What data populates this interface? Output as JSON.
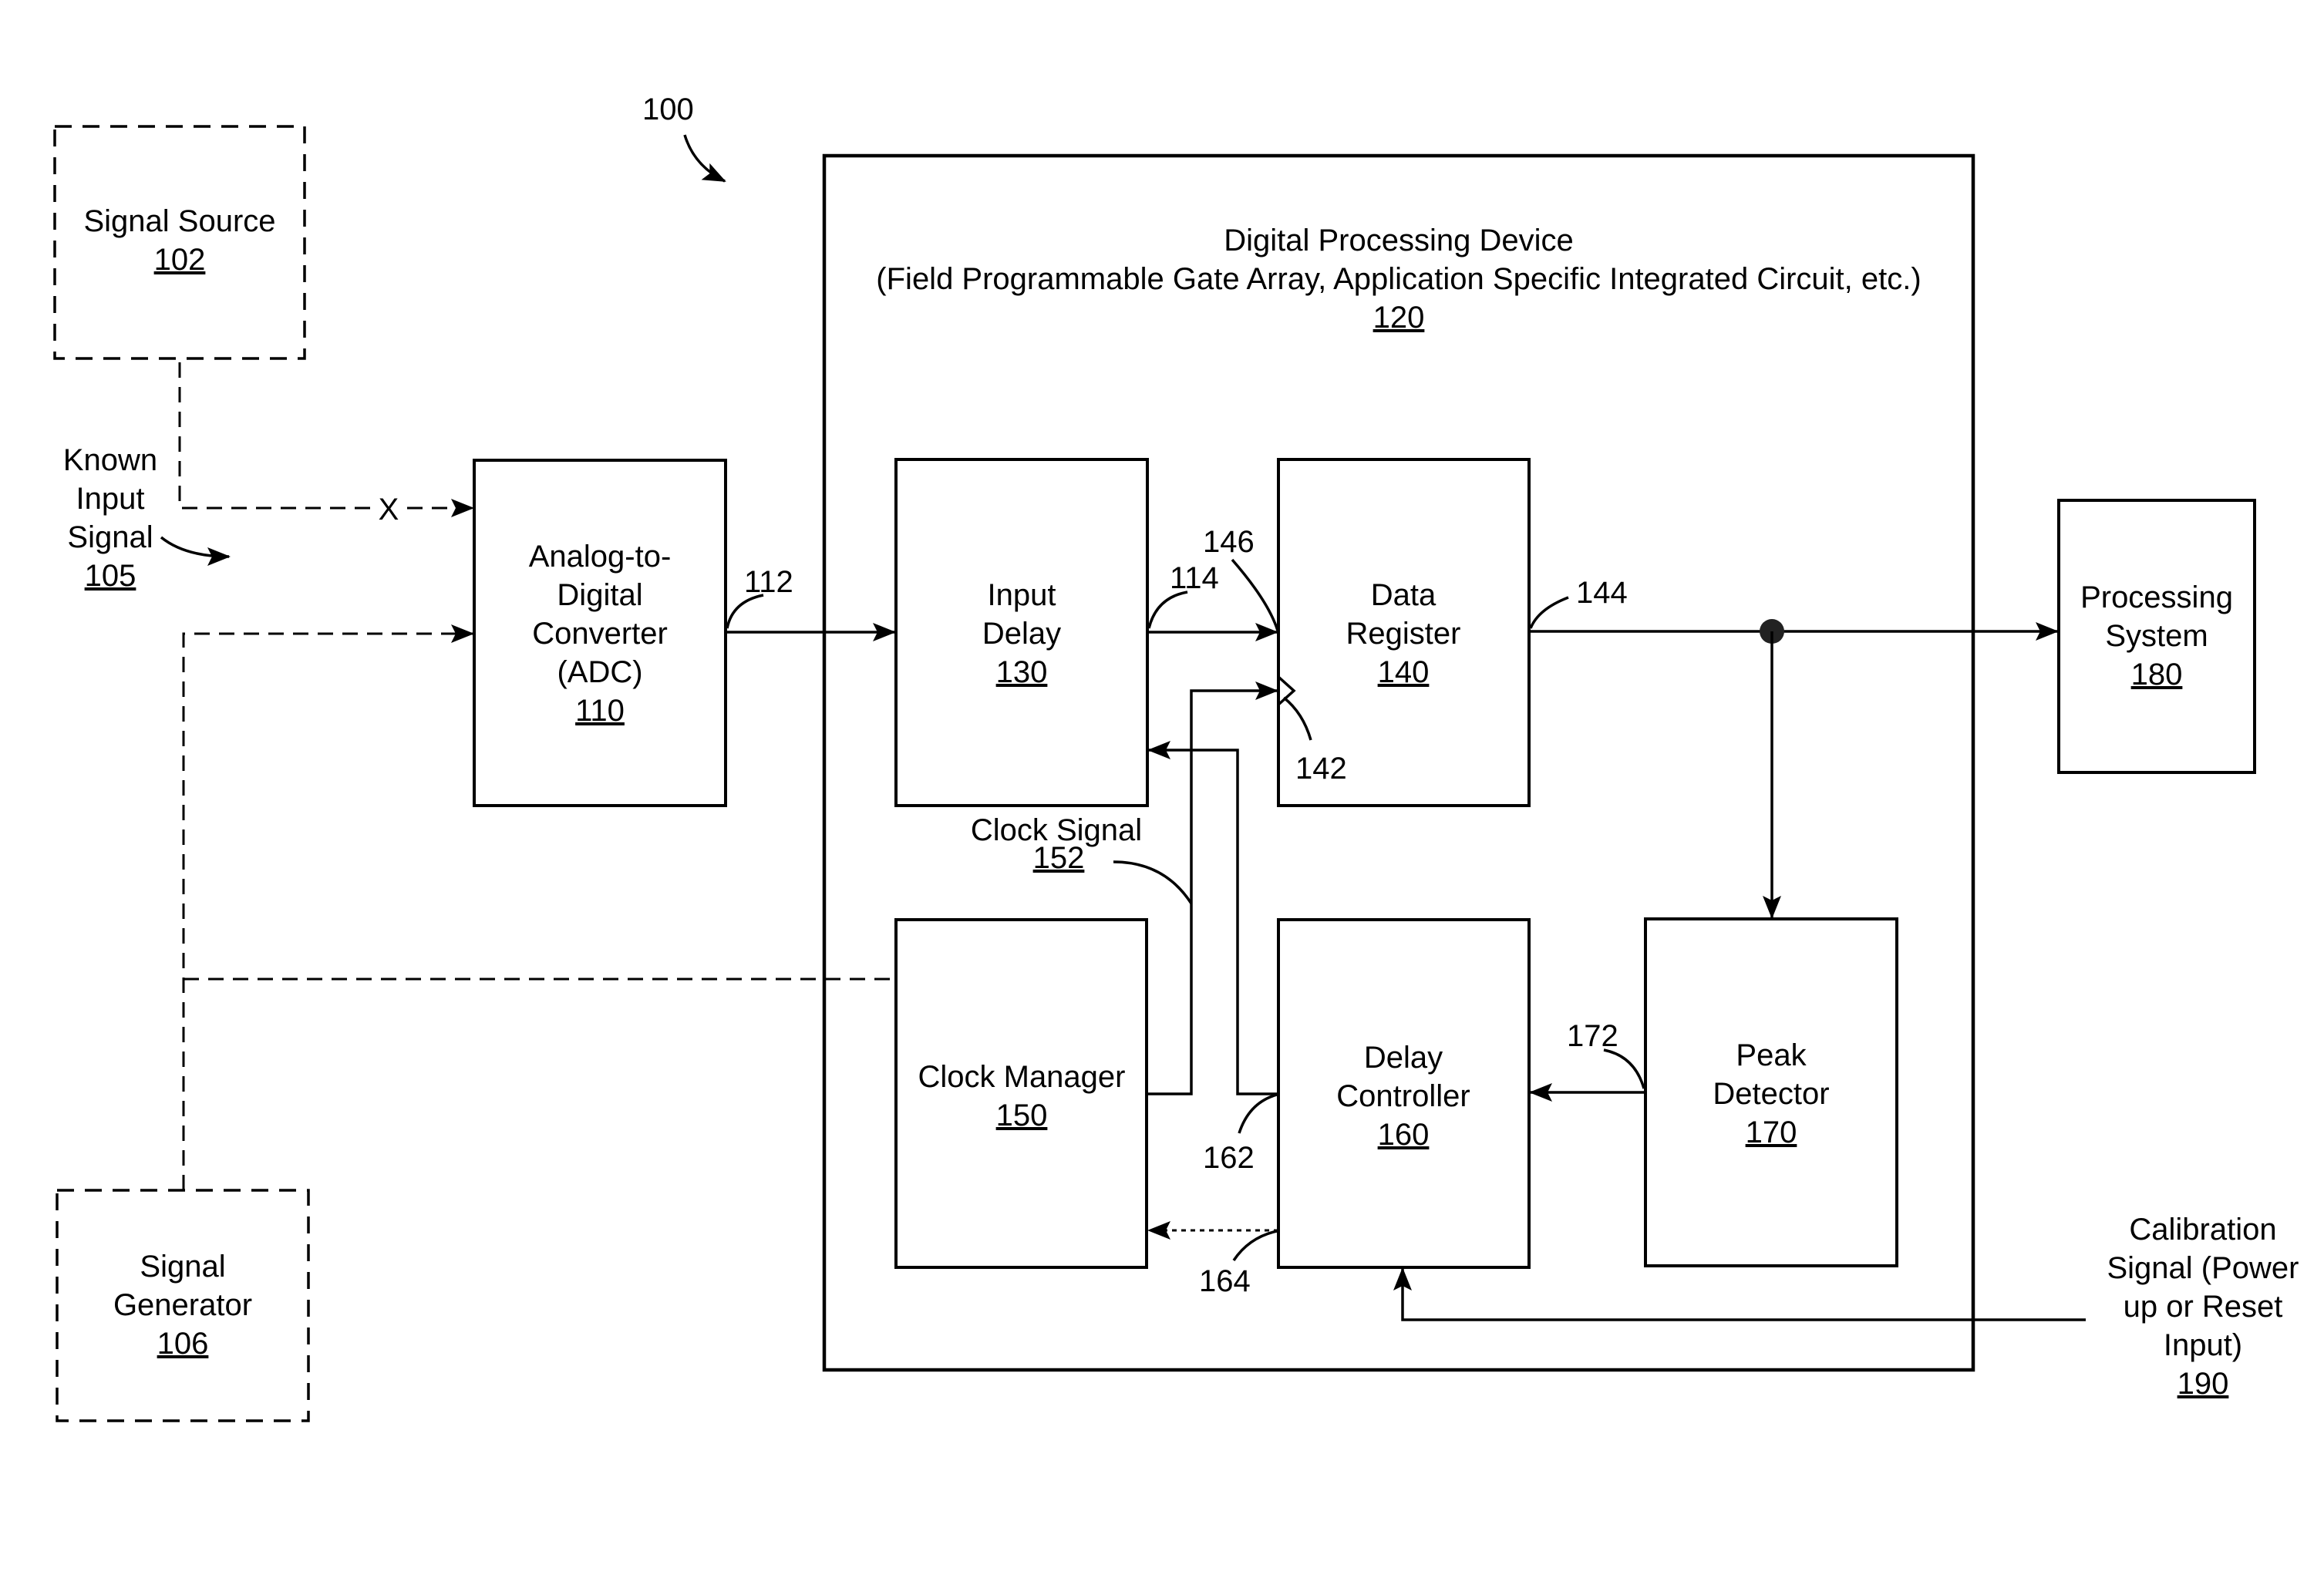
{
  "figure_ref": "100",
  "blocks": {
    "signal_source": {
      "lines": [
        "Signal Source"
      ],
      "ref": "102"
    },
    "signal_generator": {
      "lines": [
        "Signal",
        "Generator"
      ],
      "ref": "106"
    },
    "adc": {
      "lines": [
        "Analog-to-",
        "Digital",
        "Converter",
        "(ADC)"
      ],
      "ref": "110"
    },
    "digital_processing_device": {
      "lines": [
        "Digital Processing Device",
        "(Field Programmable Gate Array, Application Specific Integrated Circuit, etc.)"
      ],
      "ref": "120"
    },
    "input_delay": {
      "lines": [
        "Input",
        "Delay"
      ],
      "ref": "130"
    },
    "data_register": {
      "lines": [
        "Data",
        "Register"
      ],
      "ref": "140"
    },
    "clock_manager": {
      "lines": [
        "Clock Manager"
      ],
      "ref": "150"
    },
    "delay_controller": {
      "lines": [
        "Delay",
        "Controller"
      ],
      "ref": "160"
    },
    "peak_detector": {
      "lines": [
        "Peak",
        "Detector"
      ],
      "ref": "170"
    },
    "processing_system": {
      "lines": [
        "Processing",
        "System"
      ],
      "ref": "180"
    }
  },
  "signals": {
    "known_input": {
      "lines": [
        "Known",
        "Input",
        "Signal"
      ],
      "ref": "105"
    },
    "clock_signal": {
      "lines": [
        "Clock Signal"
      ],
      "ref": "152"
    },
    "calibration": {
      "lines": [
        "Calibration",
        "Signal (Power",
        "up or Reset",
        "Input)"
      ],
      "ref": "190"
    }
  },
  "callouts": {
    "adc_output": "112",
    "input_delay_output": "114",
    "data_register_clock_input": "142",
    "data_register_output": "144",
    "data_register_data_input": "146",
    "delay_controller_output_162": "162",
    "delay_controller_output_164": "164",
    "peak_detector_output": "172"
  },
  "disconnect_mark": "X"
}
